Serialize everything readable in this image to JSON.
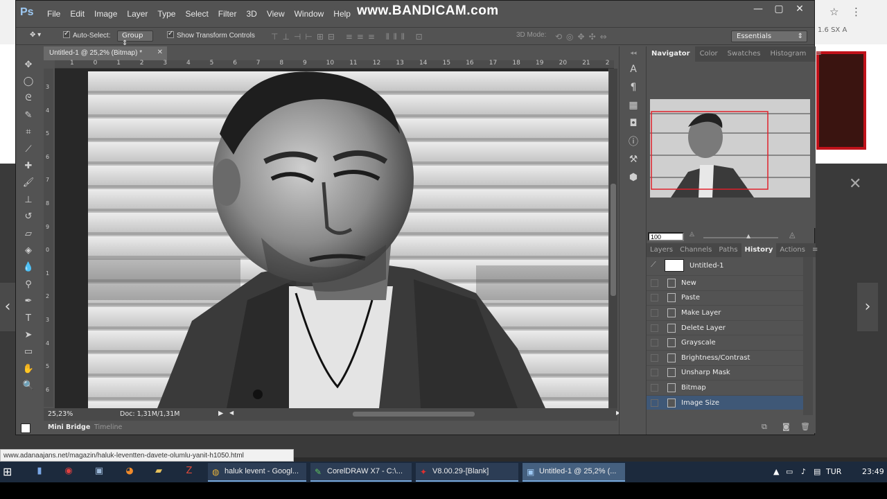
{
  "watermark": "www.BANDICAM.com",
  "app": {
    "logo": "Ps",
    "menu": [
      "File",
      "Edit",
      "Image",
      "Layer",
      "Type",
      "Select",
      "Filter",
      "3D",
      "View",
      "Window",
      "Help"
    ],
    "window_controls": [
      "minimize-icon",
      "maximize-icon",
      "close-icon"
    ]
  },
  "options_bar": {
    "auto_select_label": "Auto-Select:",
    "group_value": "Group",
    "transform_label": "Show Transform Controls",
    "mode_3d_label": "3D Mode:",
    "workspace": "Essentials"
  },
  "document": {
    "tab_title": "Untitled-1 @ 25,2% (Bitmap) *",
    "zoom": "25,23%",
    "doc_info": "Doc: 1,31M/1,31M",
    "ruler_h": [
      "1",
      "0",
      "1",
      "2",
      "3",
      "4",
      "5",
      "6",
      "7",
      "8",
      "9",
      "10",
      "11",
      "12",
      "13",
      "14",
      "15",
      "16",
      "17",
      "18",
      "19",
      "20",
      "21",
      "2"
    ],
    "ruler_v": [
      "3",
      "4",
      "5",
      "6",
      "7",
      "8",
      "9",
      "0",
      "1",
      "2",
      "3",
      "4",
      "5",
      "6"
    ]
  },
  "bottom_panel": {
    "mini_bridge": "Mini Bridge",
    "timeline": "Timeline"
  },
  "navigator_panel": {
    "tabs": [
      "Navigator",
      "Color",
      "Swatches",
      "Histogram"
    ],
    "active_tab": "Navigator",
    "zoom_value": "100"
  },
  "history_panel": {
    "tabs": [
      "Layers",
      "Channels",
      "Paths",
      "History",
      "Actions"
    ],
    "active_tab": "History",
    "snapshot": "Untitled-1",
    "states": [
      "New",
      "Paste",
      "Make Layer",
      "Delete Layer",
      "Grayscale",
      "Brightness/Contrast",
      "Unsharp Mask",
      "Bitmap",
      "Image Size"
    ],
    "selected_state": "Image Size"
  },
  "statusbar_url": "www.adanaajans.net/magazin/haluk-leventten-davete-olumlu-yanit-h1050.html",
  "taskbar": {
    "windows": [
      {
        "label": "haluk levent - Googl...",
        "icon": "chrome-icon",
        "active": false
      },
      {
        "label": "CorelDRAW X7 - C:\\...",
        "icon": "coreldraw-icon",
        "active": false
      },
      {
        "label": "V8.00.29-[Blank]",
        "icon": "app-icon",
        "active": false
      },
      {
        "label": "Untitled-1 @ 25,2% (...",
        "icon": "photoshop-icon",
        "active": true
      }
    ],
    "language": "TUR",
    "time": "23:49"
  },
  "background_browser": {
    "extension_text": "1.6 SX A"
  }
}
